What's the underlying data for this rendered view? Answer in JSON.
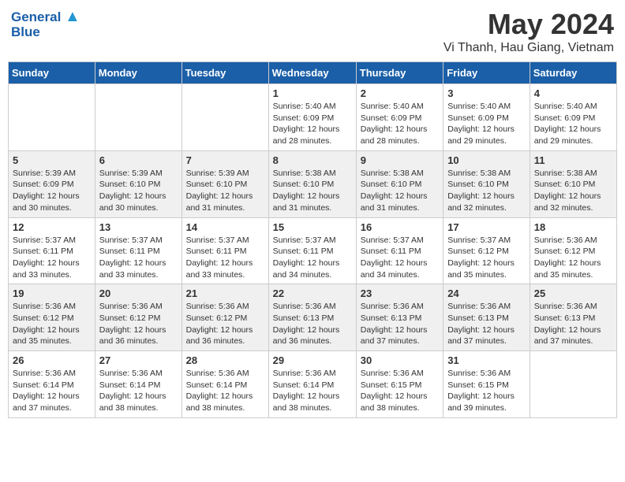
{
  "logo": {
    "line1": "General",
    "line2": "Blue"
  },
  "title": "May 2024",
  "location": "Vi Thanh, Hau Giang, Vietnam",
  "weekdays": [
    "Sunday",
    "Monday",
    "Tuesday",
    "Wednesday",
    "Thursday",
    "Friday",
    "Saturday"
  ],
  "weeks": [
    [
      {
        "day": "",
        "sunrise": "",
        "sunset": "",
        "daylight": ""
      },
      {
        "day": "",
        "sunrise": "",
        "sunset": "",
        "daylight": ""
      },
      {
        "day": "",
        "sunrise": "",
        "sunset": "",
        "daylight": ""
      },
      {
        "day": "1",
        "sunrise": "Sunrise: 5:40 AM",
        "sunset": "Sunset: 6:09 PM",
        "daylight": "Daylight: 12 hours and 28 minutes."
      },
      {
        "day": "2",
        "sunrise": "Sunrise: 5:40 AM",
        "sunset": "Sunset: 6:09 PM",
        "daylight": "Daylight: 12 hours and 28 minutes."
      },
      {
        "day": "3",
        "sunrise": "Sunrise: 5:40 AM",
        "sunset": "Sunset: 6:09 PM",
        "daylight": "Daylight: 12 hours and 29 minutes."
      },
      {
        "day": "4",
        "sunrise": "Sunrise: 5:40 AM",
        "sunset": "Sunset: 6:09 PM",
        "daylight": "Daylight: 12 hours and 29 minutes."
      }
    ],
    [
      {
        "day": "5",
        "sunrise": "Sunrise: 5:39 AM",
        "sunset": "Sunset: 6:09 PM",
        "daylight": "Daylight: 12 hours and 30 minutes."
      },
      {
        "day": "6",
        "sunrise": "Sunrise: 5:39 AM",
        "sunset": "Sunset: 6:10 PM",
        "daylight": "Daylight: 12 hours and 30 minutes."
      },
      {
        "day": "7",
        "sunrise": "Sunrise: 5:39 AM",
        "sunset": "Sunset: 6:10 PM",
        "daylight": "Daylight: 12 hours and 31 minutes."
      },
      {
        "day": "8",
        "sunrise": "Sunrise: 5:38 AM",
        "sunset": "Sunset: 6:10 PM",
        "daylight": "Daylight: 12 hours and 31 minutes."
      },
      {
        "day": "9",
        "sunrise": "Sunrise: 5:38 AM",
        "sunset": "Sunset: 6:10 PM",
        "daylight": "Daylight: 12 hours and 31 minutes."
      },
      {
        "day": "10",
        "sunrise": "Sunrise: 5:38 AM",
        "sunset": "Sunset: 6:10 PM",
        "daylight": "Daylight: 12 hours and 32 minutes."
      },
      {
        "day": "11",
        "sunrise": "Sunrise: 5:38 AM",
        "sunset": "Sunset: 6:10 PM",
        "daylight": "Daylight: 12 hours and 32 minutes."
      }
    ],
    [
      {
        "day": "12",
        "sunrise": "Sunrise: 5:37 AM",
        "sunset": "Sunset: 6:11 PM",
        "daylight": "Daylight: 12 hours and 33 minutes."
      },
      {
        "day": "13",
        "sunrise": "Sunrise: 5:37 AM",
        "sunset": "Sunset: 6:11 PM",
        "daylight": "Daylight: 12 hours and 33 minutes."
      },
      {
        "day": "14",
        "sunrise": "Sunrise: 5:37 AM",
        "sunset": "Sunset: 6:11 PM",
        "daylight": "Daylight: 12 hours and 33 minutes."
      },
      {
        "day": "15",
        "sunrise": "Sunrise: 5:37 AM",
        "sunset": "Sunset: 6:11 PM",
        "daylight": "Daylight: 12 hours and 34 minutes."
      },
      {
        "day": "16",
        "sunrise": "Sunrise: 5:37 AM",
        "sunset": "Sunset: 6:11 PM",
        "daylight": "Daylight: 12 hours and 34 minutes."
      },
      {
        "day": "17",
        "sunrise": "Sunrise: 5:37 AM",
        "sunset": "Sunset: 6:12 PM",
        "daylight": "Daylight: 12 hours and 35 minutes."
      },
      {
        "day": "18",
        "sunrise": "Sunrise: 5:36 AM",
        "sunset": "Sunset: 6:12 PM",
        "daylight": "Daylight: 12 hours and 35 minutes."
      }
    ],
    [
      {
        "day": "19",
        "sunrise": "Sunrise: 5:36 AM",
        "sunset": "Sunset: 6:12 PM",
        "daylight": "Daylight: 12 hours and 35 minutes."
      },
      {
        "day": "20",
        "sunrise": "Sunrise: 5:36 AM",
        "sunset": "Sunset: 6:12 PM",
        "daylight": "Daylight: 12 hours and 36 minutes."
      },
      {
        "day": "21",
        "sunrise": "Sunrise: 5:36 AM",
        "sunset": "Sunset: 6:12 PM",
        "daylight": "Daylight: 12 hours and 36 minutes."
      },
      {
        "day": "22",
        "sunrise": "Sunrise: 5:36 AM",
        "sunset": "Sunset: 6:13 PM",
        "daylight": "Daylight: 12 hours and 36 minutes."
      },
      {
        "day": "23",
        "sunrise": "Sunrise: 5:36 AM",
        "sunset": "Sunset: 6:13 PM",
        "daylight": "Daylight: 12 hours and 37 minutes."
      },
      {
        "day": "24",
        "sunrise": "Sunrise: 5:36 AM",
        "sunset": "Sunset: 6:13 PM",
        "daylight": "Daylight: 12 hours and 37 minutes."
      },
      {
        "day": "25",
        "sunrise": "Sunrise: 5:36 AM",
        "sunset": "Sunset: 6:13 PM",
        "daylight": "Daylight: 12 hours and 37 minutes."
      }
    ],
    [
      {
        "day": "26",
        "sunrise": "Sunrise: 5:36 AM",
        "sunset": "Sunset: 6:14 PM",
        "daylight": "Daylight: 12 hours and 37 minutes."
      },
      {
        "day": "27",
        "sunrise": "Sunrise: 5:36 AM",
        "sunset": "Sunset: 6:14 PM",
        "daylight": "Daylight: 12 hours and 38 minutes."
      },
      {
        "day": "28",
        "sunrise": "Sunrise: 5:36 AM",
        "sunset": "Sunset: 6:14 PM",
        "daylight": "Daylight: 12 hours and 38 minutes."
      },
      {
        "day": "29",
        "sunrise": "Sunrise: 5:36 AM",
        "sunset": "Sunset: 6:14 PM",
        "daylight": "Daylight: 12 hours and 38 minutes."
      },
      {
        "day": "30",
        "sunrise": "Sunrise: 5:36 AM",
        "sunset": "Sunset: 6:15 PM",
        "daylight": "Daylight: 12 hours and 38 minutes."
      },
      {
        "day": "31",
        "sunrise": "Sunrise: 5:36 AM",
        "sunset": "Sunset: 6:15 PM",
        "daylight": "Daylight: 12 hours and 39 minutes."
      },
      {
        "day": "",
        "sunrise": "",
        "sunset": "",
        "daylight": ""
      }
    ]
  ]
}
